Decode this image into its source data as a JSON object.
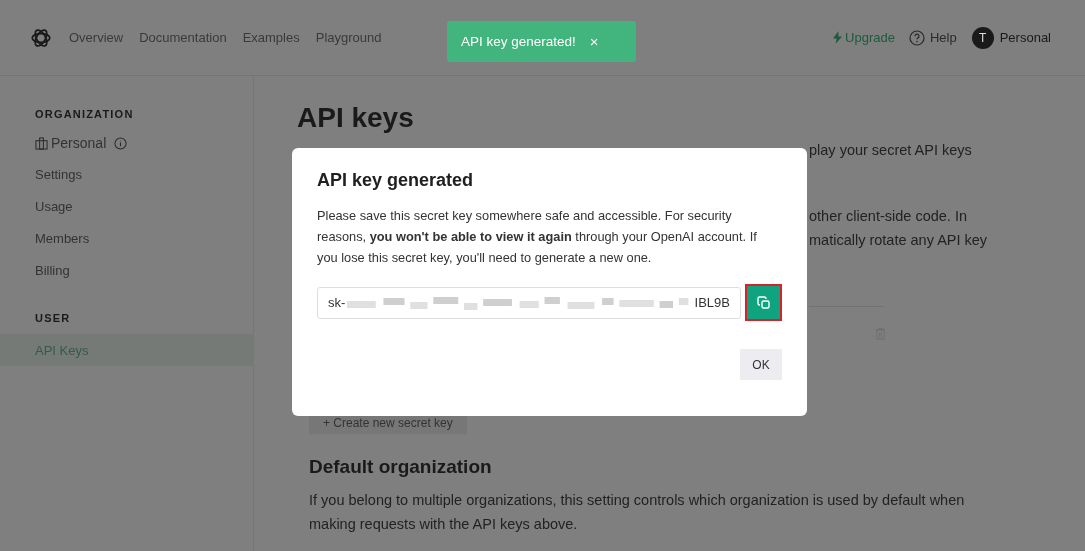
{
  "nav": {
    "items": [
      {
        "label": "Overview"
      },
      {
        "label": "Documentation"
      },
      {
        "label": "Examples"
      },
      {
        "label": "Playground"
      }
    ],
    "upgrade": "Upgrade",
    "help": "Help",
    "avatar_initial": "T",
    "account": "Personal"
  },
  "toast": {
    "message": "API key generated!",
    "close": "×"
  },
  "sidebar": {
    "sections": [
      {
        "heading": "ORGANIZATION",
        "items": [
          {
            "label": "Personal",
            "kind": "org",
            "selected": false
          },
          {
            "label": "Settings",
            "kind": "link",
            "selected": false
          },
          {
            "label": "Usage",
            "kind": "link",
            "selected": false
          },
          {
            "label": "Members",
            "kind": "link",
            "selected": false
          },
          {
            "label": "Billing",
            "kind": "link",
            "selected": false
          }
        ]
      },
      {
        "heading": "USER",
        "items": [
          {
            "label": "API Keys",
            "kind": "link",
            "selected": true
          }
        ]
      }
    ]
  },
  "main": {
    "title": "API keys",
    "visible_fragments": [
      "play your secret API keys",
      "other client-side code. In",
      "matically rotate any API key"
    ],
    "create_button": "+ Create new secret key",
    "default_org_heading": "Default organization",
    "default_org_text": "If you belong to multiple organizations, this setting controls which organization is used by default when making requests with the API keys above."
  },
  "modal": {
    "title": "API key generated",
    "text": "Please save this secret key somewhere safe and accessible. For security reasons, **you won't be able to view it again** through your OpenAI account. If you lose this secret key, you'll need to generate a new one.",
    "key_prefix": "sk-",
    "key_suffix": "IBL9B",
    "ok": "OK"
  }
}
